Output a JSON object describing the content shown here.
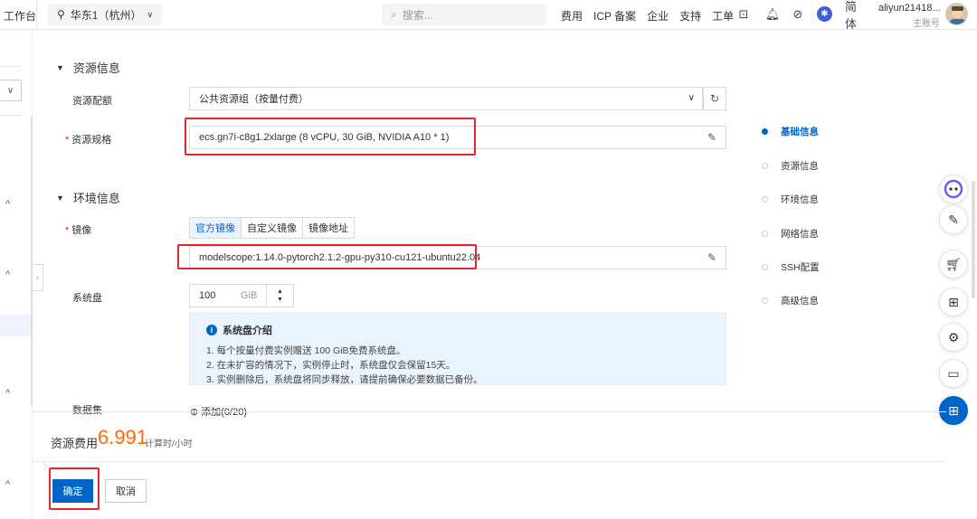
{
  "topbar": {
    "workbench": "工作台",
    "region": "华东1（杭州）",
    "search_placeholder": "搜索...",
    "links": [
      "费用",
      "ICP 备案",
      "企业",
      "支持",
      "工单"
    ],
    "lang": "简体",
    "user_name": "aliyun21418...",
    "user_role": "主账号"
  },
  "resource_section": {
    "title": "资源信息",
    "quota_label": "资源配额",
    "quota_value": "公共资源组（按量付费）",
    "spec_label": "资源规格",
    "spec_value": "ecs.gn7i-c8g1.2xlarge  (8 vCPU, 30 GiB, NVIDIA A10 * 1)"
  },
  "env_section": {
    "title": "环境信息",
    "image_label": "镜像",
    "image_tabs": [
      "官方镜像",
      "自定义镜像",
      "镜像地址"
    ],
    "image_value": "modelscope:1.14.0-pytorch2.1.2-gpu-py310-cu121-ubuntu22.04",
    "disk_label": "系统盘",
    "disk_value": "100",
    "disk_unit": "GiB",
    "disk_info_title": "系统盘介绍",
    "disk_info_lines": [
      "1. 每个按量付费实例赠送 100 GiB免费系统盘。",
      "2. 在未扩容的情况下，实例停止时，系统盘仅会保留15天。",
      "3. 实例删除后，系统盘将同步释放，请提前确保必要数据已备份。"
    ],
    "dataset_label": "数据集",
    "dataset_add": "⊕ 添加(0/20)"
  },
  "anchor_nav": [
    "基础信息",
    "资源信息",
    "环境信息",
    "网络信息",
    "SSH配置",
    "高级信息"
  ],
  "footer": {
    "price_label": "资源费用",
    "price_value": "6.991",
    "price_unit": "计算时/小时",
    "confirm": "确定",
    "cancel": "取消"
  },
  "colors": {
    "accent": "#0064c8",
    "price": "#ff6a00",
    "highlight_box": "#e0282e"
  },
  "icons": [
    "location-pin-icon",
    "search-icon",
    "terminal-icon",
    "bell-icon",
    "help-icon",
    "settings-icon",
    "edit-icon",
    "cart-icon",
    "doc-icon",
    "gear-icon",
    "chat-icon",
    "grid-icon",
    "bot-icon"
  ]
}
